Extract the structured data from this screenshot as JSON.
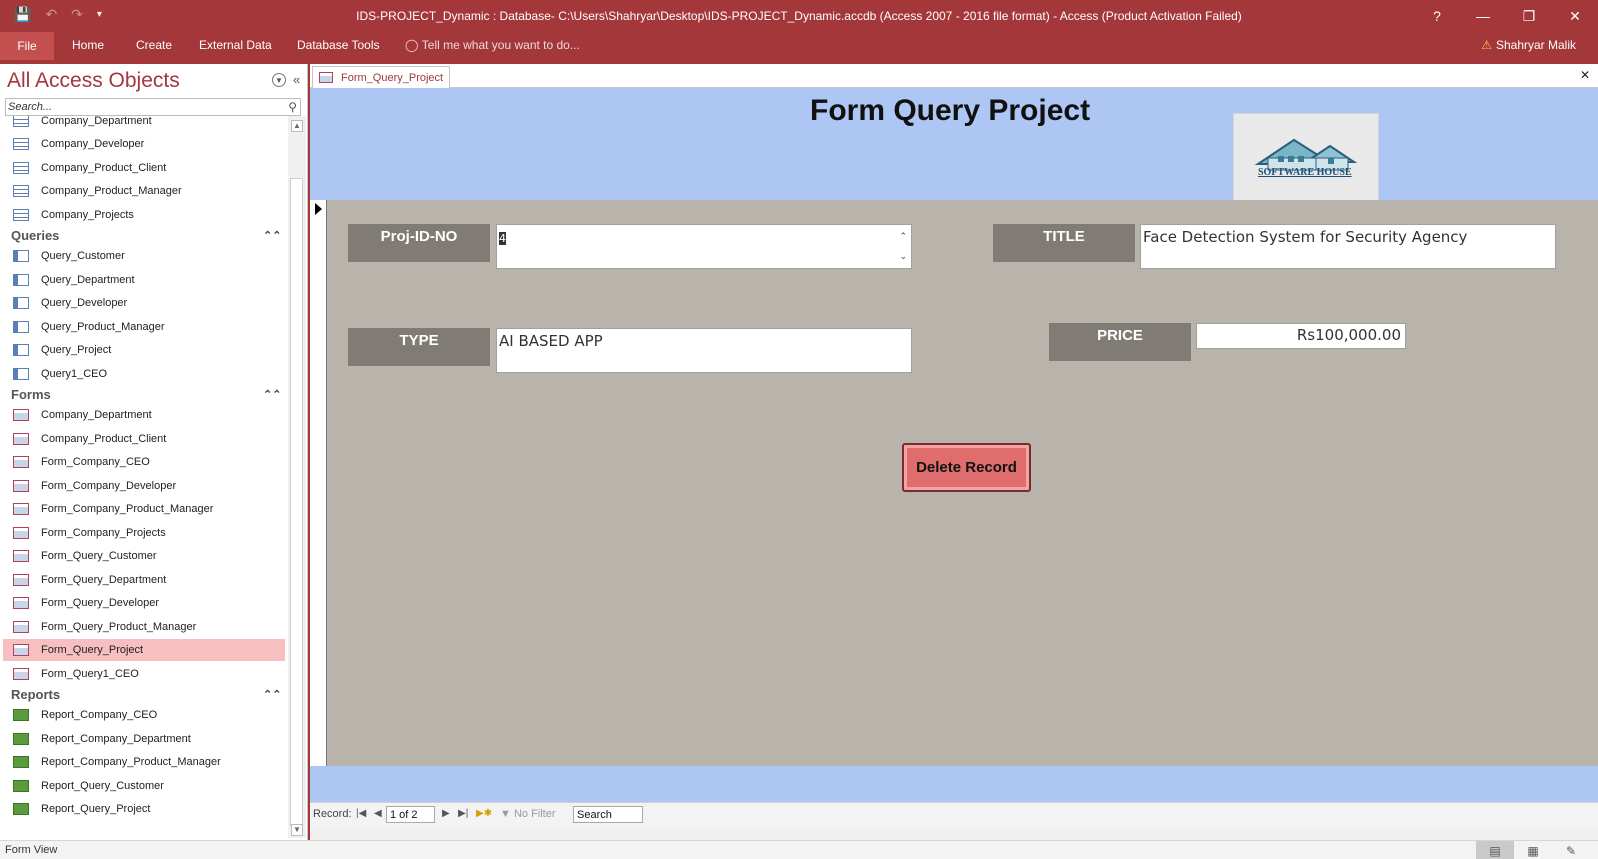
{
  "window": {
    "title": "IDS-PROJECT_Dynamic : Database- C:\\Users\\Shahryar\\Desktop\\IDS-PROJECT_Dynamic.accdb (Access 2007 - 2016 file format) - Access (Product Activation Failed)",
    "controls": [
      "?",
      "—",
      "❐",
      "✕"
    ]
  },
  "ribbon": {
    "file": "File",
    "tabs": [
      "Home",
      "Create",
      "External Data",
      "Database Tools"
    ],
    "tell_me": "Tell me what you want to do...",
    "user": "Shahryar Malik"
  },
  "nav": {
    "title": "All Access Objects",
    "search_placeholder": "Search...",
    "tables": [
      "Company_Department",
      "Company_Developer",
      "Company_Product_Client",
      "Company_Product_Manager",
      "Company_Projects"
    ],
    "queries_label": "Queries",
    "queries": [
      "Query_Customer",
      "Query_Department",
      "Query_Developer",
      "Query_Product_Manager",
      "Query_Project",
      "Query1_CEO"
    ],
    "forms_label": "Forms",
    "forms": [
      "Company_Department",
      "Company_Product_Client",
      "Form_Company_CEO",
      "Form_Company_Developer",
      "Form_Company_Product_Manager",
      "Form_Company_Projects",
      "Form_Query_Customer",
      "Form_Query_Department",
      "Form_Query_Developer",
      "Form_Query_Product_Manager",
      "Form_Query_Project",
      "Form_Query1_CEO"
    ],
    "reports_label": "Reports",
    "reports": [
      "Report_Company_CEO",
      "Report_Company_Department",
      "Report_Company_Product_Manager",
      "Report_Query_Customer",
      "Report_Query_Project"
    ],
    "selected_form": "Form_Query_Project"
  },
  "doc": {
    "tab_label": "Form_Query_Project",
    "form_title": "Form Query Project",
    "logo_text": "SOFTWARE HOUSE",
    "fields": {
      "proj_id_label": "Proj-ID-NO",
      "proj_id_value": "4",
      "title_label": "TITLE",
      "title_value": "Face Detection System for Security Agency",
      "type_label": "TYPE",
      "type_value": "AI BASED APP",
      "price_label": "PRICE",
      "price_value": "Rs100,000.00"
    },
    "delete_button": "Delete Record"
  },
  "record_nav": {
    "label": "Record:",
    "current": "1 of 2",
    "filter": "No Filter",
    "search": "Search"
  },
  "status": {
    "text": "Form View"
  }
}
